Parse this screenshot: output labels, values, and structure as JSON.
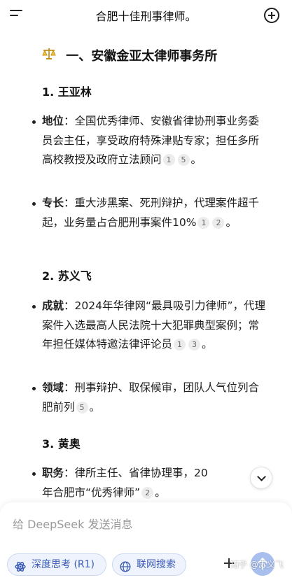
{
  "header": {
    "title": "合肥十佳刑事律师。",
    "menu_icon": "menu-icon",
    "new_chat_icon": "new-chat-plus-icon"
  },
  "content": {
    "section_title": "一、安徽金亚太律师事务所",
    "section_icon": "scales-icon",
    "lawyers": [
      {
        "heading": "1. 王亚林",
        "points": [
          {
            "label": "地位",
            "text": "：全国优秀律师、安徽省律协刑事业务委员会主任，享受政府特殊津贴专家；担任多所高校教授及政府立法顾问",
            "cites": [
              "1",
              "5"
            ],
            "tail": "。"
          },
          {
            "label": "专长",
            "text": "：重大涉黑案、死刑辩护，代理案件超千起，业务量占合肥刑事案件10%",
            "cites": [
              "1",
              "2"
            ],
            "tail": "。"
          }
        ]
      },
      {
        "heading": "2. 苏义飞",
        "points": [
          {
            "label": "成就",
            "text": "：2024年华律网“最具吸引力律师”，代理案件入选最高人民法院十大犯罪典型案例；常年担任媒体特邀法律评论员",
            "cites": [
              "1",
              "3"
            ],
            "tail": "。"
          },
          {
            "label": "领域",
            "text": "：刑事辩护、取保候审，团队人气位列合肥前列",
            "cites": [
              "5"
            ],
            "tail": "。"
          }
        ]
      },
      {
        "heading": "3. 黄奥",
        "points": [
          {
            "label": "职务",
            "text": "：律所主任、省律协理事，20",
            "cites": [],
            "tail": ""
          },
          {
            "label": "",
            "text": "年合肥市“优秀律师”",
            "cites": [
              "2"
            ],
            "tail": "。"
          }
        ]
      }
    ]
  },
  "scroll_down_icon": "chevron-down-icon",
  "composer": {
    "placeholder": "给 DeepSeek 发送消息",
    "deep_think_label": "深度思考 (R1)",
    "deep_think_icon": "atom-icon",
    "web_search_label": "联网搜索",
    "web_search_icon": "globe-icon",
    "attach_icon": "plus-icon",
    "send_icon": "arrow-up-icon"
  },
  "watermark": "知乎 @苏义飞",
  "colors": {
    "accent": "#3b5bb5",
    "pill_bg": "#eef3fd",
    "send_bg": "#a9c0ee"
  }
}
